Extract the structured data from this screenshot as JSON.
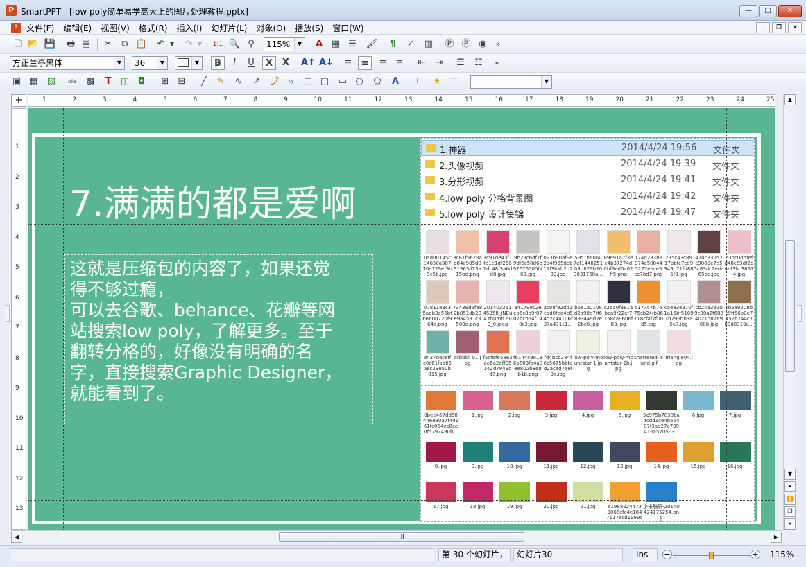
{
  "window": {
    "app_icon": "P",
    "title": "SmartPPT - [low poly简单易学高大上的图片处理教程.pptx]",
    "controls": [
      "minimize-icon",
      "maximize-icon",
      "close-icon"
    ]
  },
  "menubar": {
    "items": [
      "文件(F)",
      "编辑(E)",
      "视图(V)",
      "格式(R)",
      "插入(I)",
      "幻灯片(L)",
      "对象(O)",
      "播放(S)",
      "窗口(W)"
    ]
  },
  "toolbar": {
    "zoom_value": "115%",
    "overflow": "»"
  },
  "format_toolbar": {
    "font_name": "方正兰亭黑体",
    "font_size": "36",
    "bold": "B",
    "italic": "I",
    "underline": "U",
    "strike": "X",
    "strike2": "X",
    "overflow": "»"
  },
  "ruler": {
    "h_numbers": [
      "1",
      "2",
      "3",
      "4",
      "5",
      "6",
      "7",
      "8",
      "9",
      "10",
      "11",
      "12",
      "13",
      "14",
      "15",
      "16",
      "17",
      "18",
      "19",
      "20",
      "21",
      "22",
      "23",
      "24",
      "25"
    ],
    "v_numbers": [
      "1",
      "2",
      "3",
      "4",
      "5",
      "6",
      "7",
      "8",
      "9",
      "10",
      "11",
      "12",
      "13"
    ]
  },
  "slide": {
    "background_color": "#58b791",
    "title": "7.满满的都是爱啊",
    "body_lines": [
      "这就是压缩包的内容了，如果还觉",
      "得不够过瘾，",
      "可以去谷歌、behance、花瓣等网",
      "站搜索low poly，了解更多。至于",
      "翻转分格的，好像没有明确的名",
      "字，直接搜索Graphic Designer，",
      "就能看到了。"
    ],
    "screenshot": {
      "folders": [
        {
          "name": "1.神器",
          "date": "2014/4/24 19:56",
          "type": "文件夹"
        },
        {
          "name": "2.头像视频",
          "date": "2014/4/24 19:39",
          "type": "文件夹"
        },
        {
          "name": "3.分形视频",
          "date": "2014/4/24 19:41",
          "type": "文件夹"
        },
        {
          "name": "4.low poly 分格背景图",
          "date": "2014/4/24 19:42",
          "type": "文件夹"
        },
        {
          "name": "5.low poly 设计集锦",
          "date": "2014/4/24 19:47",
          "type": "文件夹"
        }
      ],
      "thumbs_row1": [
        {
          "label": "0ad00145c14650a98710e129ef9b9c5b.jpg",
          "color": "#e8e0e0"
        },
        {
          "label": "3c81f5628ab84a985d891363d25a15bd.png",
          "color": "#f0c0a8"
        },
        {
          "label": "3c91de43f1fb1e1df2681dc48f3a6dd8.jpg",
          "color": "#d84070"
        },
        {
          "label": "9b29c6df7f9df6c58d6b97626500bf63.jpg",
          "color": "#c8c4c0"
        },
        {
          "label": "023b90af9e2a4f955deb11f3bab2d233.jpg",
          "color": "#f4f4f0"
        },
        {
          "label": "59c7b60607ef1440251b3d829b203031768a...",
          "color": "#e4e0ec"
        },
        {
          "label": "89e91a7f3ec4b37274d0bf9ed0a62ff5.png",
          "color": "#f0c070"
        },
        {
          "label": "174d28388974e588445272eece5ec7bd7.png",
          "color": "#e8b0a0"
        },
        {
          "label": "295c43c8917bbfc7cd9349b71fd885f8.jpg",
          "color": "#f0e8e8"
        },
        {
          "label": "410c93052c9080e7e55c83dc2eda65be.jpg",
          "color": "#604040"
        },
        {
          "label": "b3bc0ddfefd48c63df2d4ef3bc38674.jpg",
          "color": "#f0c0c8"
        }
      ],
      "thumbs_row2": [
        {
          "label": "07811e3c35adb3e56bf66600720f964a.png",
          "color": "#e0c8b8"
        },
        {
          "label": "73439d6fa82b851db29e9a4531c3508a.png",
          "color": "#e8b4b0"
        },
        {
          "label": "20140326145358_jNEu4.thumb.600_0.jpeg",
          "color": "#f0e8f0"
        },
        {
          "label": "a41799c2eeb6c8b9f0707bcb54f140c3.jpg",
          "color": "#e84060"
        },
        {
          "label": "ac98f92dd1cad0fea4c6452c44106f37a431c1...",
          "color": "#e8e4e0"
        },
        {
          "label": "b6e1a0108d2a98d7ff6893449d2e2bc8.jpg",
          "color": "#f4f0f0"
        },
        {
          "label": "c3ba0f881abca9f22ef7158ca9606f83.jpg",
          "color": "#303040"
        },
        {
          "label": "c17757b7675cb24fb86718cfaf7f00d5.jpg",
          "color": "#f09030"
        },
        {
          "label": "caea3e970f1a15bf51093b796bb3a5e7.jpg",
          "color": "#f4f0f0"
        },
        {
          "label": "cb24a39209c80a2f6884021d876968b.jpg",
          "color": "#b09090"
        },
        {
          "label": "cb5a9208bc9ff56b0e7452b744c780d8319a...",
          "color": "#907050"
        }
      ],
      "thumbs_row3": [
        {
          "label": "d437deceffc0c61faa05aec33e50b015.jpg",
          "color": "#70b0a8"
        },
        {
          "label": "drbbbl_01.jpg",
          "color": "#a06070"
        },
        {
          "label": "f5cf6f658e3ae6a2dff05142d7949dd7.png",
          "color": "#e07050"
        },
        {
          "label": "f6144c98136b603fb4a0ee802b8e8b1b.png",
          "color": "#f0d0d8"
        },
        {
          "label": "fd4bcb284f6c5675bbfad2acad7aef3a.jpg",
          "color": "#f4f0f0"
        },
        {
          "label": "low-poly-mountstar-1.jpg",
          "color": "#f0f0e0"
        },
        {
          "label": "low-poly-mountstar-2b.jpg",
          "color": "#f4f0f0"
        },
        {
          "label": "shattered-island.gif",
          "color": "#e0e4e8"
        },
        {
          "label": "Triangle04.jpg",
          "color": "#f4dce0"
        }
      ],
      "gallery_row1": [
        {
          "label": "0bee467dd58446e80a7f40161fc054ec8ce0f6792490b...",
          "color": "#e07838"
        },
        {
          "label": "1.jpg",
          "color": "#d86090"
        },
        {
          "label": "2.jpg",
          "color": "#d87858"
        },
        {
          "label": "3.jpg",
          "color": "#c82838"
        },
        {
          "label": "4.jpg",
          "color": "#c860a0"
        },
        {
          "label": "5.jpg",
          "color": "#e8b020"
        },
        {
          "label": "5c975b7838ba4cdd1ce4b56407f3ad27a739416a5705-G...",
          "color": "#303830"
        },
        {
          "label": "6.jpg",
          "color": "#78b8d0"
        },
        {
          "label": "7.jpg",
          "color": "#406070"
        }
      ],
      "gallery_row2": [
        {
          "label": "8.jpg",
          "color": "#a01848"
        },
        {
          "label": "9.jpg",
          "color": "#208078"
        },
        {
          "label": "10.jpg",
          "color": "#3868a0"
        },
        {
          "label": "11.jpg",
          "color": "#781830"
        },
        {
          "label": "12.jpg",
          "color": "#284858"
        },
        {
          "label": "13.jpg",
          "color": "#404860"
        },
        {
          "label": "14.jpg",
          "color": "#e86020"
        },
        {
          "label": "15.jpg",
          "color": "#e0a030"
        },
        {
          "label": "16.jpg",
          "color": "#287858"
        }
      ],
      "gallery_row3": [
        {
          "label": "17.jpg",
          "color": "#c83858"
        },
        {
          "label": "18.jpg",
          "color": "#c02868"
        },
        {
          "label": "19.jpg",
          "color": "#90c030"
        },
        {
          "label": "20.jpg",
          "color": "#c03018"
        },
        {
          "label": "21.jpg",
          "color": "#d0e0a0"
        },
        {
          "label": "619882244739066cfc4e1847117ecd19995",
          "color": "#f0a030"
        },
        {
          "label": "小米触屏-20140424175254.png",
          "color": "#2880c8"
        }
      ]
    }
  },
  "statusbar": {
    "slide_position": "第 30 个幻灯片，",
    "slide_name": "幻灯片30",
    "mode": "Ins",
    "zoom_minus": "−",
    "zoom_plus": "+",
    "zoom_percent": "115%"
  },
  "hscroll": {
    "grip": "III"
  }
}
